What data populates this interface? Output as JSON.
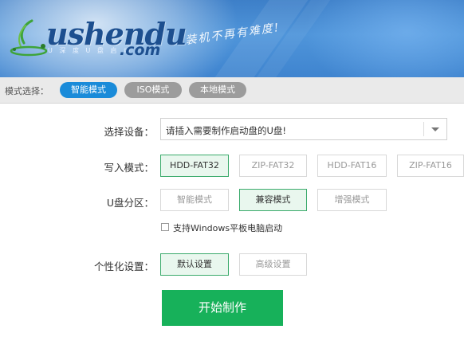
{
  "header": {
    "logo_text": "ushendu",
    "logo_sub": "U 深 度 U 盘 启 动",
    "logo_domain": ".com",
    "slogan": "装机不再有难度!"
  },
  "mode_bar": {
    "label": "模式选择：",
    "modes": [
      {
        "label": "智能模式",
        "active": true
      },
      {
        "label": "ISO模式",
        "active": false
      },
      {
        "label": "本地模式",
        "active": false
      }
    ]
  },
  "form": {
    "device": {
      "label": "选择设备：",
      "value": "请插入需要制作启动盘的U盘!"
    },
    "write_mode": {
      "label": "写入模式：",
      "options": [
        {
          "label": "HDD-FAT32",
          "selected": true
        },
        {
          "label": "ZIP-FAT32",
          "selected": false
        },
        {
          "label": "HDD-FAT16",
          "selected": false
        },
        {
          "label": "ZIP-FAT16",
          "selected": false
        }
      ]
    },
    "partition": {
      "label": "U盘分区：",
      "options": [
        {
          "label": "智能模式",
          "selected": false
        },
        {
          "label": "兼容模式",
          "selected": true
        },
        {
          "label": "增强模式",
          "selected": false
        }
      ]
    },
    "tablet_support": {
      "label": "支持Windows平板电脑启动",
      "checked": false
    },
    "personalize": {
      "label": "个性化设置：",
      "options": [
        {
          "label": "默认设置",
          "selected": true
        },
        {
          "label": "高级设置",
          "selected": false
        }
      ]
    },
    "start_label": "开始制作"
  },
  "colors": {
    "accent_blue": "#1a8bd9",
    "selected_green": "#3aaa6b",
    "start_green": "#17b15a",
    "banner_blue": "#4f95da"
  }
}
